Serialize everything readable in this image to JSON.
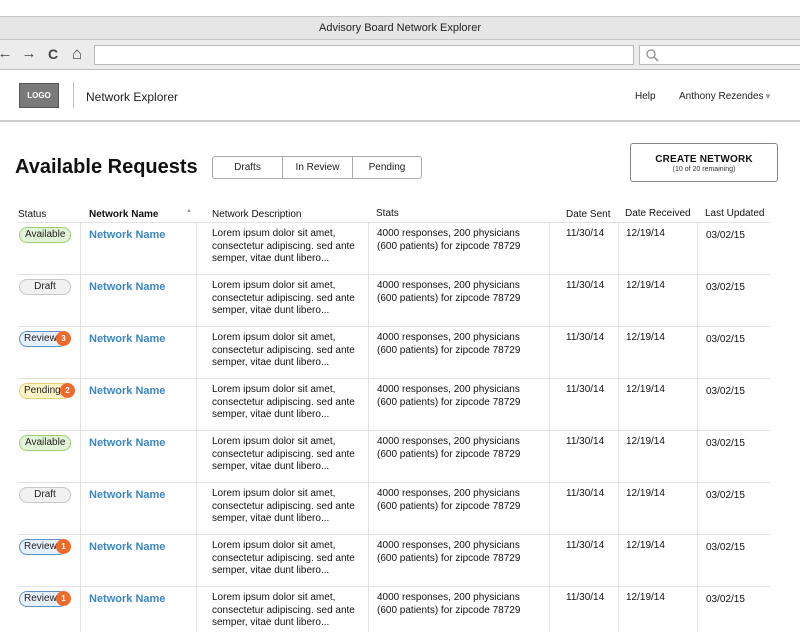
{
  "browser": {
    "window_title": "Advisory Board Network Explorer",
    "nav": {
      "back": "←",
      "forward": "→",
      "reload": "C",
      "home": "⌂"
    }
  },
  "header": {
    "logo": "LOGO",
    "app_title": "Network Explorer",
    "help": "Help",
    "user": "Anthony Rezendes",
    "user_caret": "▼"
  },
  "page": {
    "title": "Available Requests",
    "tabs": [
      "Drafts",
      "In Review",
      "Pending"
    ],
    "create_button": {
      "label": "CREATE NETWORK",
      "sublabel": "(10 of 20 remaining)"
    }
  },
  "table": {
    "columns": [
      "Status",
      "Network Name",
      "Network Description",
      "Stats",
      "Date Sent",
      "Date Received",
      "Last Updated"
    ],
    "rows": [
      {
        "status": "Available",
        "count": "",
        "name": "Network Name",
        "desc1": "Lorem ipsum dolor sit amet,",
        "desc2": "consectetur adipiscing. sed ante",
        "desc3": "semper, vitae dunt libero...",
        "stats1": "4000 responses, 200 physicians",
        "stats2": "(600 patients) for zipcode 78729",
        "sent": "11/30/14",
        "received": "12/19/14",
        "updated": "03/02/15"
      },
      {
        "status": "Draft",
        "count": "",
        "name": "Network Name",
        "desc1": "Lorem ipsum dolor sit amet,",
        "desc2": "consectetur adipiscing. sed ante",
        "desc3": "semper, vitae dunt libero...",
        "stats1": "4000 responses, 200 physicians",
        "stats2": "(600 patients) for zipcode 78729",
        "sent": "11/30/14",
        "received": "12/19/14",
        "updated": "03/02/15"
      },
      {
        "status": "Review",
        "count": "3",
        "name": "Network Name",
        "desc1": "Lorem ipsum dolor sit amet,",
        "desc2": "consectetur adipiscing. sed ante",
        "desc3": "semper, vitae dunt libero...",
        "stats1": "4000 responses, 200 physicians",
        "stats2": "(600 patients) for zipcode 78729",
        "sent": "11/30/14",
        "received": "12/19/14",
        "updated": "03/02/15"
      },
      {
        "status": "Pending",
        "count": "2",
        "name": "Network Name",
        "desc1": "Lorem ipsum dolor sit amet,",
        "desc2": "consectetur adipiscing. sed ante",
        "desc3": "semper, vitae dunt libero...",
        "stats1": "4000 responses, 200 physicians",
        "stats2": "(600 patients) for zipcode 78729",
        "sent": "11/30/14",
        "received": "12/19/14",
        "updated": "03/02/15"
      },
      {
        "status": "Available",
        "count": "",
        "name": "Network Name",
        "desc1": "Lorem ipsum dolor sit amet,",
        "desc2": "consectetur adipiscing. sed ante",
        "desc3": "semper, vitae dunt libero...",
        "stats1": "4000 responses, 200 physicians",
        "stats2": "(600 patients) for zipcode 78729",
        "sent": "11/30/14",
        "received": "12/19/14",
        "updated": "03/02/15"
      },
      {
        "status": "Draft",
        "count": "",
        "name": "Network Name",
        "desc1": "Lorem ipsum dolor sit amet,",
        "desc2": "consectetur adipiscing. sed ante",
        "desc3": "semper, vitae dunt libero...",
        "stats1": "4000 responses, 200 physicians",
        "stats2": "(600 patients) for zipcode 78729",
        "sent": "11/30/14",
        "received": "12/19/14",
        "updated": "03/02/15"
      },
      {
        "status": "Review",
        "count": "1",
        "name": "Network Name",
        "desc1": "Lorem ipsum dolor sit amet,",
        "desc2": "consectetur adipiscing. sed ante",
        "desc3": "semper, vitae dunt libero...",
        "stats1": "4000 responses, 200 physicians",
        "stats2": "(600 patients) for zipcode 78729",
        "sent": "11/30/14",
        "received": "12/19/14",
        "updated": "03/02/15"
      },
      {
        "status": "Review",
        "count": "1",
        "name": "Network Name",
        "desc1": "Lorem ipsum dolor sit amet,",
        "desc2": "consectetur adipiscing. sed ante",
        "desc3": "semper, vitae dunt libero...",
        "stats1": "4000 responses, 200 physicians",
        "stats2": "(600 patients) for zipcode 78729",
        "sent": "11/30/14",
        "received": "12/19/14",
        "updated": "03/02/15"
      }
    ]
  }
}
